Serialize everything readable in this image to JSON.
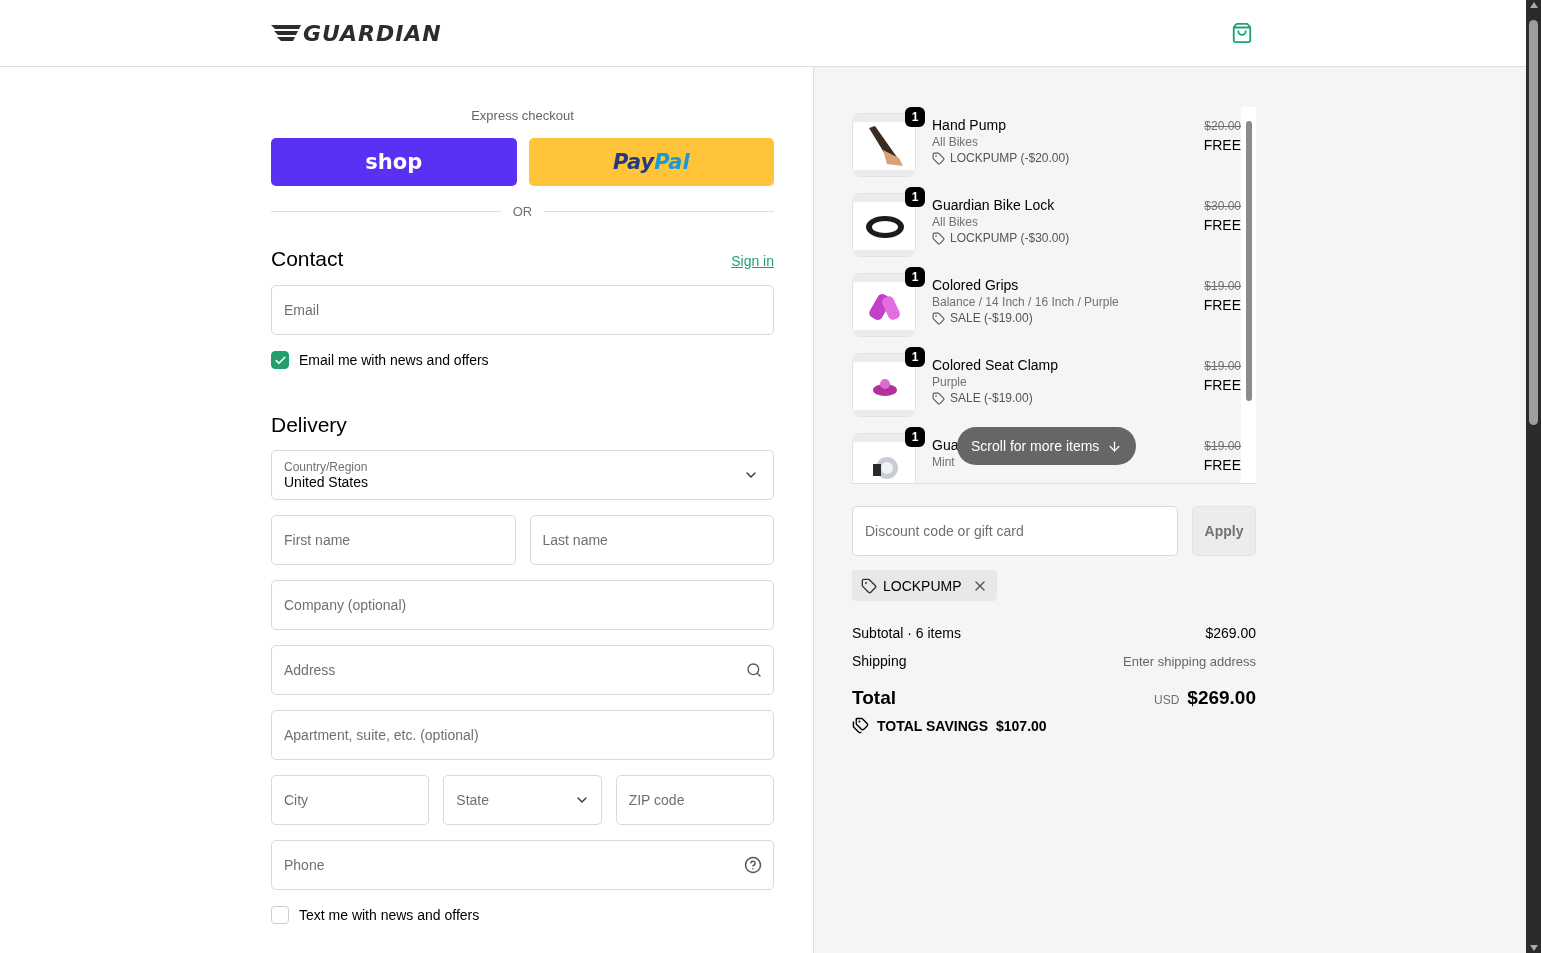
{
  "header": {
    "logo": "GUARDIAN"
  },
  "express": {
    "label": "Express checkout",
    "buttons": [
      {
        "kind": "shop",
        "label": "shop"
      },
      {
        "kind": "paypal",
        "label": "Pay",
        "label_accent": "Pal"
      }
    ],
    "divider": "OR"
  },
  "contact": {
    "heading": "Contact",
    "sign_in": "Sign in",
    "email_placeholder": "Email",
    "news": {
      "label": "Email me with news and offers",
      "checked": true
    }
  },
  "delivery": {
    "heading": "Delivery",
    "country": {
      "label": "Country/Region",
      "value": "United States"
    },
    "rows": [
      [
        {
          "placeholder": "First name",
          "kind": "text"
        },
        {
          "placeholder": "Last name",
          "kind": "text"
        }
      ],
      [
        {
          "placeholder": "Company (optional)",
          "kind": "text"
        }
      ],
      [
        {
          "placeholder": "Address",
          "kind": "search"
        }
      ],
      [
        {
          "placeholder": "Apartment, suite, etc. (optional)",
          "kind": "text"
        }
      ],
      [
        {
          "placeholder": "City",
          "kind": "text"
        },
        {
          "placeholder": "State",
          "kind": "select"
        },
        {
          "placeholder": "ZIP code",
          "kind": "text"
        }
      ],
      [
        {
          "placeholder": "Phone",
          "kind": "help"
        }
      ]
    ],
    "sms": {
      "label": "Text me with news and offers",
      "checked": false
    }
  },
  "summary": {
    "items": [
      {
        "quantity": "1",
        "name": "Hand Pump",
        "variant": "All Bikes",
        "discount": "LOCKPUMP (-$20.00)",
        "compare_price": "$20.00",
        "price": "FREE"
      },
      {
        "quantity": "1",
        "name": "Guardian Bike Lock",
        "variant": "All Bikes",
        "discount": "LOCKPUMP (-$30.00)",
        "compare_price": "$30.00",
        "price": "FREE"
      },
      {
        "quantity": "1",
        "name": "Colored Grips",
        "variant": "Balance / 14 Inch / 16 Inch / Purple",
        "discount": "SALE (-$19.00)",
        "compare_price": "$19.00",
        "price": "FREE"
      },
      {
        "quantity": "1",
        "name": "Colored Seat Clamp",
        "variant": "Purple",
        "discount": "SALE (-$19.00)",
        "compare_price": "$19.00",
        "price": "FREE"
      },
      {
        "quantity": "1",
        "name": "Gua",
        "variant": "Mint",
        "compare_price": "$19.00",
        "price": "FREE"
      }
    ],
    "scroll_hint": "Scroll for more items",
    "discount": {
      "placeholder": "Discount code or gift card",
      "apply": "Apply",
      "disabled": true
    },
    "codes": [
      {
        "code": "LOCKPUMP"
      }
    ],
    "subtotal_label": "Subtotal · 6 items",
    "subtotal": "$269.00",
    "shipping_label": "Shipping",
    "shipping": "Enter shipping address",
    "total_label": "Total",
    "currency": "USD",
    "total": "$269.00",
    "savings_label": "TOTAL SAVINGS",
    "savings": "$107.00"
  }
}
